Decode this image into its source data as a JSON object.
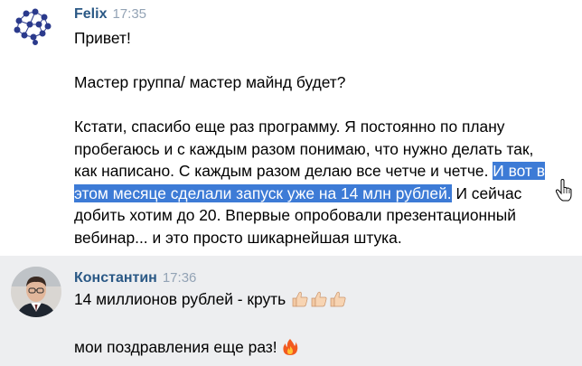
{
  "messages": [
    {
      "author": "Felix",
      "time": "17:35",
      "lines": {
        "l1": "Привет!",
        "l2": "Мастер группа/ мастер майнд будет?",
        "l3": "Кстати, спасибо еще раз программу. Я постоянно по плану",
        "l4": "пробегаюсь и с каждым разом понимаю, что нужно делать так,",
        "l5a": "как написано. С каждым разом делаю все четче и четче. ",
        "l5b": "И вот в",
        "l6a": "этом месяце сделали запуск уже на 14 млн рублей.",
        "l6b": " И сейчас",
        "l7": "добить хотим до 20. Впервые опробовали презентационный",
        "l8": "вебинар... и это просто шикарнейшая штука."
      }
    },
    {
      "author": "Константин",
      "time": "17:36",
      "lines": {
        "l1": "14 миллионов рублей - круть",
        "l2": "мои поздравления еще раз!"
      },
      "emojis": [
        "thumbs-up",
        "thumbs-up",
        "thumbs-up",
        "fire"
      ]
    }
  ],
  "colors": {
    "author": "#2a5885",
    "time": "#93a3b5",
    "selection": "#3d7bd6",
    "highlighted_row": "#edeef0"
  },
  "icons": [
    "brain-avatar",
    "person-avatar",
    "thumbs-up-icon",
    "fire-icon",
    "text-cursor-hand-icon"
  ]
}
